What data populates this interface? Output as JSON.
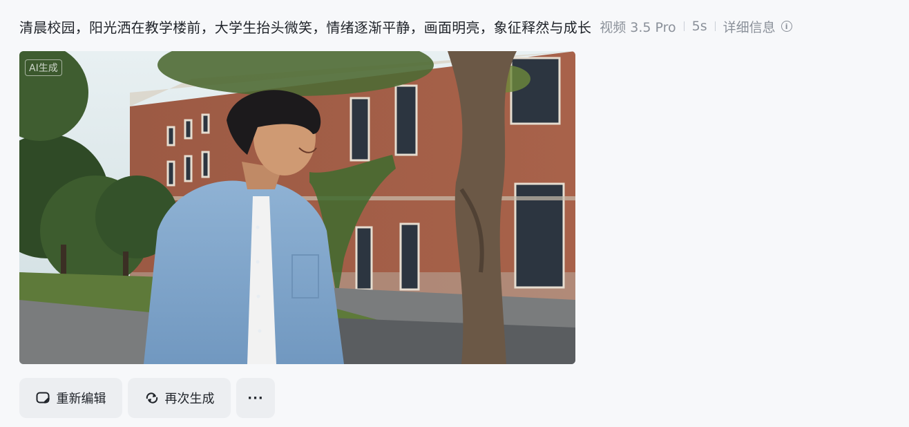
{
  "header": {
    "prompt": "清晨校园，阳光洒在教学楼前，大学生抬头微笑，情绪逐渐平静，画面明亮，象征释然与成长",
    "model": "视频 3.5 Pro",
    "duration": "5s",
    "detail_label": "详细信息",
    "detail_icon": "info-icon"
  },
  "video": {
    "badge": "AI生成"
  },
  "actions": {
    "edit_label": "重新编辑",
    "regen_label": "再次生成",
    "more_label": "···"
  }
}
